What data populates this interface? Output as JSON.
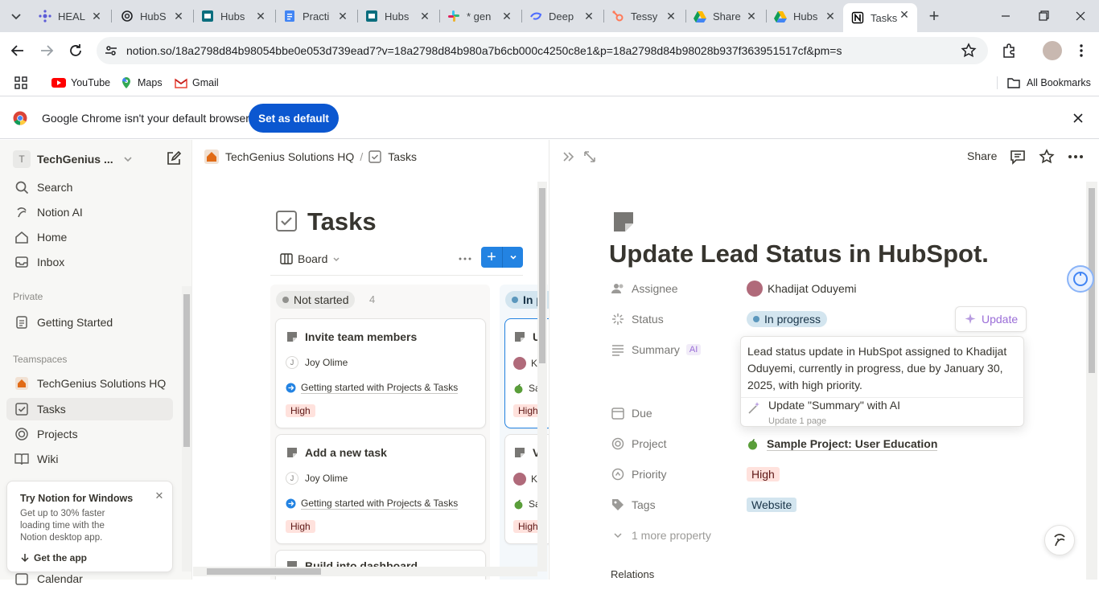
{
  "browser": {
    "tabs": [
      {
        "title": "HEAL",
        "icon": "hubspot-sprocket-icon"
      },
      {
        "title": "HubS",
        "icon": "chatgpt-icon"
      },
      {
        "title": "Hubs",
        "icon": "hubspot-doc-icon"
      },
      {
        "title": "Practi",
        "icon": "google-docs-icon"
      },
      {
        "title": "Hubs",
        "icon": "hubspot-doc-icon"
      },
      {
        "title": "* gen",
        "icon": "slack-icon"
      },
      {
        "title": "Deep",
        "icon": "deepseek-icon"
      },
      {
        "title": "Tessy",
        "icon": "hubspot-icon"
      },
      {
        "title": "Share",
        "icon": "google-drive-icon"
      },
      {
        "title": "Hubs",
        "icon": "google-drive-icon"
      },
      {
        "title": "Tasks",
        "icon": "notion-icon",
        "active": true
      }
    ],
    "url": "notion.so/18a2798d84b98054bbe0e053d739ead7?v=18a2798d84b980a7b6cb000c4250c8e1&p=18a2798d84b98028b937f363951517cf&pm=s",
    "bookmarks": [
      {
        "label": "YouTube",
        "icon": "youtube-icon"
      },
      {
        "label": "Maps",
        "icon": "maps-icon"
      },
      {
        "label": "Gmail",
        "icon": "gmail-icon"
      }
    ],
    "all_bookmarks": "All Bookmarks",
    "infobar": {
      "message": "Google Chrome isn't your default browser",
      "button": "Set as default"
    }
  },
  "sidebar": {
    "workspace_initial": "T",
    "workspace": "TechGenius ...",
    "nav": [
      {
        "label": "Search",
        "icon": "search-icon"
      },
      {
        "label": "Notion AI",
        "icon": "notion-ai-icon"
      },
      {
        "label": "Home",
        "icon": "home-icon"
      },
      {
        "label": "Inbox",
        "icon": "inbox-icon"
      }
    ],
    "private_label": "Private",
    "private_items": [
      {
        "label": "Getting Started"
      }
    ],
    "teamspaces_label": "Teamspaces",
    "teamspace": "TechGenius Solutions HQ",
    "team_items": [
      {
        "label": "Tasks"
      },
      {
        "label": "Projects"
      },
      {
        "label": "Wiki"
      },
      {
        "label": "Calendar"
      }
    ],
    "promo": {
      "title": "Try Notion for Windows",
      "body": "Get up to 30% faster loading time with the Notion desktop app.",
      "link": "Get the app"
    }
  },
  "board": {
    "breadcrumb": [
      "TechGenius Solutions HQ",
      "Tasks"
    ],
    "title": "Tasks",
    "view": "Board",
    "columns": [
      {
        "name": "Not started",
        "count": "4"
      },
      {
        "name": "In p"
      }
    ],
    "cards": [
      {
        "title": "Invite team members",
        "assignee_initial": "J",
        "assignee": "Joy Olime",
        "project": "Getting started with Projects & Tasks",
        "priority": "High"
      },
      {
        "title": "Add a new task",
        "assignee_initial": "J",
        "assignee": "Joy Olime",
        "project": "Getting started with Projects & Tasks",
        "priority": "High"
      },
      {
        "title": "Build into dashboard..."
      }
    ],
    "col2_cards": [
      {
        "title": "U",
        "assignee": "K",
        "project": "Sa",
        "priority": "High"
      },
      {
        "title": "V",
        "assignee": "K",
        "project": "Sa",
        "priority": "High"
      }
    ]
  },
  "peek": {
    "share": "Share",
    "title": "Update Lead Status in HubSpot.",
    "props": {
      "assignee_label": "Assignee",
      "assignee": "Khadijat Oduyemi",
      "status_label": "Status",
      "status": "In progress",
      "summary_label": "Summary",
      "ai_badge": "AI",
      "due_label": "Due",
      "project_label": "Project",
      "project": "Sample Project: User Education",
      "priority_label": "Priority",
      "priority": "High",
      "tags_label": "Tags",
      "tag": "Website",
      "more": "1 more property",
      "relations": "Relations"
    },
    "update_button": "Update",
    "popup": {
      "summary_text": "Lead status update in HubSpot assigned to Khadijat Oduyemi, currently in progress, due by January 30, 2025, with high priority.",
      "action": "Update \"Summary\" with AI",
      "subaction": "Update 1 page"
    }
  },
  "colors": {
    "accent": "#2383e2",
    "chrome_blue": "#0b57d0",
    "high_tag_bg": "#ffe2dd",
    "status_bg": "#d3e5ef"
  }
}
